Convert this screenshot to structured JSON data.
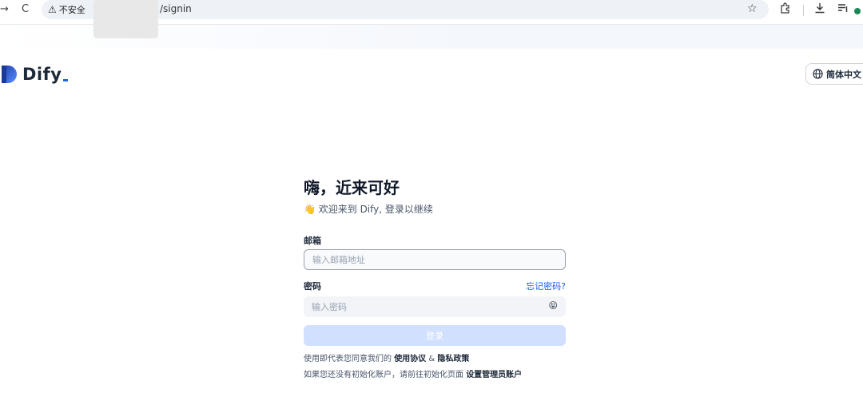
{
  "browser": {
    "back_glyph": "→",
    "reload_glyph": "C",
    "security_label": "不安全",
    "url": "/signin",
    "icons": [
      "star-icon",
      "extensions-icon",
      "download-icon",
      "reading-list-icon"
    ]
  },
  "header": {
    "logo_text": "Dify",
    "language_button": "简体中文"
  },
  "login": {
    "title": "嗨，近来可好",
    "subtitle": "👋 欢迎来到 Dify, 登录以继续",
    "email_label": "邮箱",
    "email_placeholder": "输入邮箱地址",
    "password_label": "密码",
    "forgot_password": "忘记密码?",
    "password_placeholder": "输入密码",
    "eye_glyph": "😝",
    "submit_label": "登录",
    "terms_prefix": "使用即代表您同意我们的 ",
    "terms_link": "使用协议",
    "terms_and": " & ",
    "privacy_link": "隐私政策",
    "init_prefix": "如果您还没有初始化账户，请前往初始化页面 ",
    "init_link": "设置管理员账户"
  },
  "colors": {
    "accent": "#155eef",
    "button_disabled": "#d1e0ff",
    "logo_blue": "#2563eb"
  }
}
